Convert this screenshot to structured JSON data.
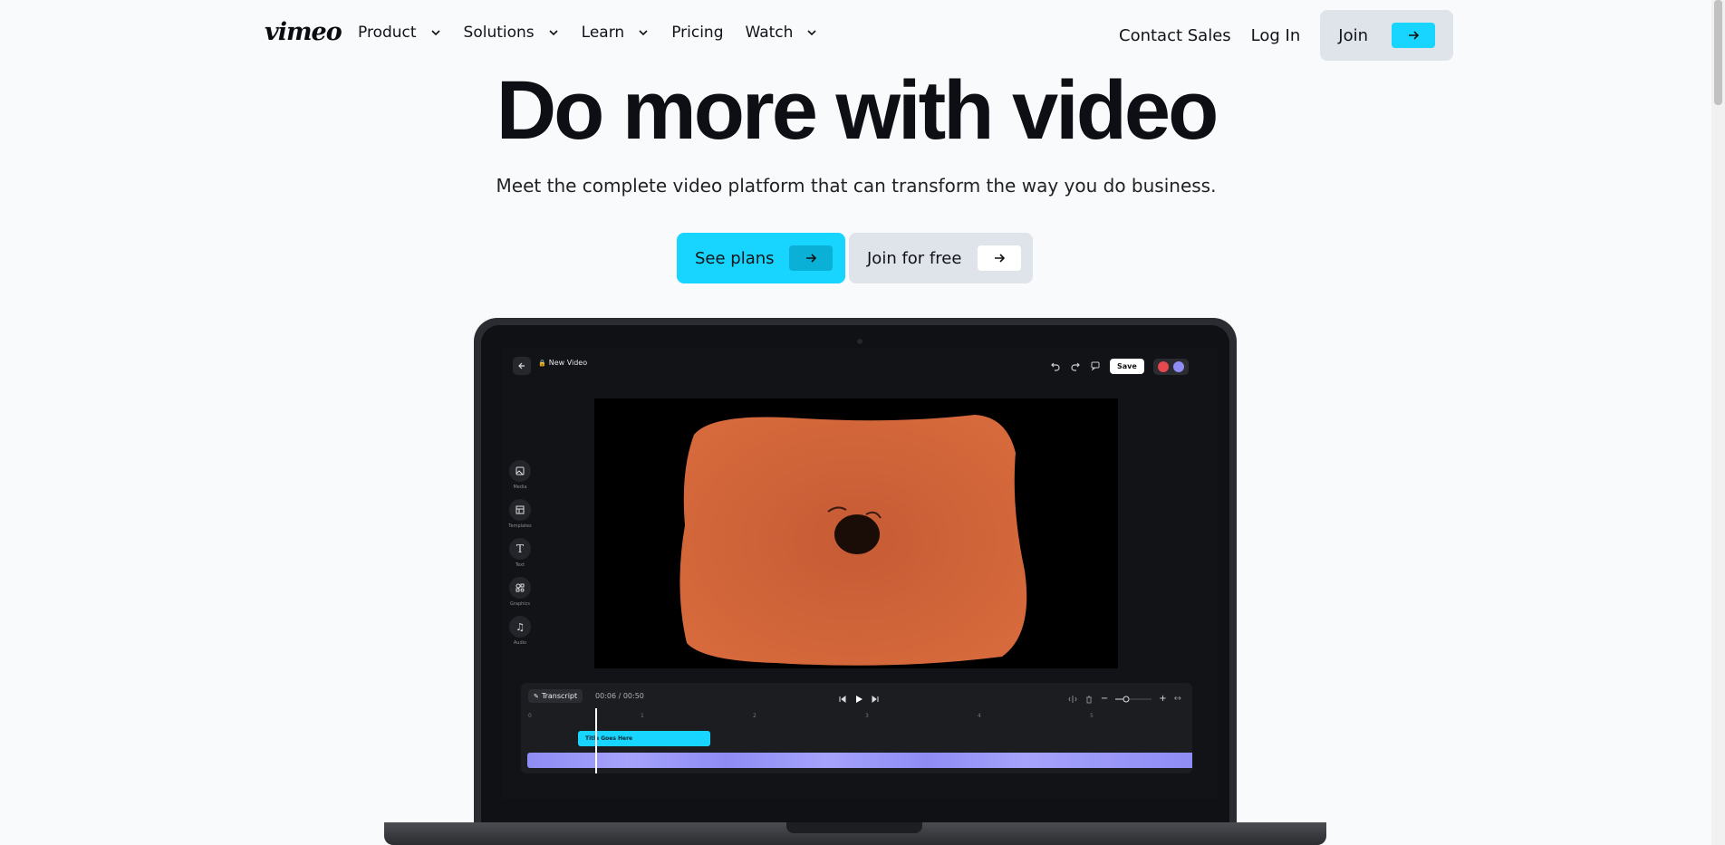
{
  "brand": "vimeo",
  "nav": {
    "items": [
      {
        "label": "Product",
        "has_menu": true
      },
      {
        "label": "Solutions",
        "has_menu": true
      },
      {
        "label": "Learn",
        "has_menu": true
      },
      {
        "label": "Pricing",
        "has_menu": false
      },
      {
        "label": "Watch",
        "has_menu": true
      }
    ],
    "contact": "Contact Sales",
    "login": "Log In",
    "join": "Join"
  },
  "hero": {
    "title": "Do more with video",
    "subtitle": "Meet the complete video platform that can transform the way you do business.",
    "cta_primary": "See plans",
    "cta_secondary": "Join for free"
  },
  "editor": {
    "doc_title": "New Video",
    "save": "Save",
    "sidebar": [
      "Media",
      "Templates",
      "Text",
      "Graphics",
      "Audio"
    ],
    "transcript": "Transcript",
    "timecode": "00:06 / 00:50",
    "ruler": [
      "0",
      "1",
      "2",
      "3",
      "4",
      "5"
    ],
    "title_clip": "Title Goes Here"
  },
  "colors": {
    "accent": "#17d5ff",
    "bg": "#f8fafc",
    "secondary": "#dfe3ea"
  }
}
